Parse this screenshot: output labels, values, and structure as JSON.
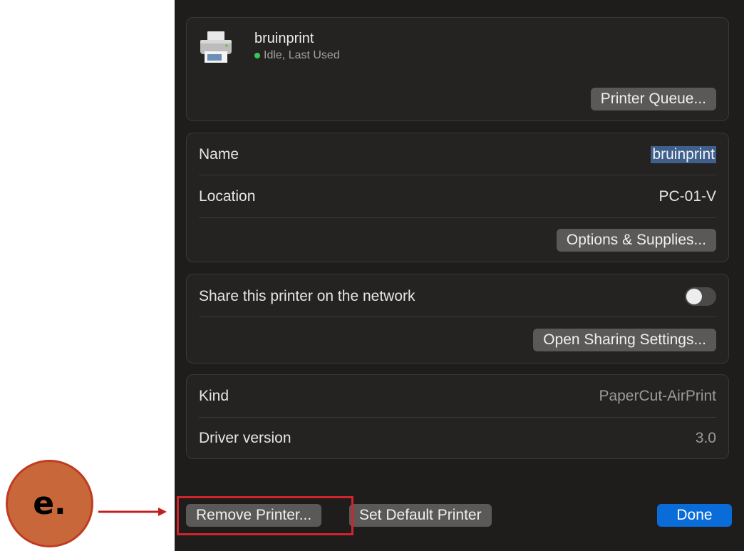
{
  "printer": {
    "name": "bruinprint",
    "status": "Idle, Last Used",
    "status_color": "#34c759",
    "queue_button": "Printer Queue..."
  },
  "details": {
    "name_label": "Name",
    "name_value": "bruinprint",
    "location_label": "Location",
    "location_value": "PC-01-V",
    "options_button": "Options & Supplies..."
  },
  "sharing": {
    "label": "Share this printer on the network",
    "toggle_on": false,
    "settings_button": "Open Sharing Settings..."
  },
  "info": {
    "kind_label": "Kind",
    "kind_value": "PaperCut-AirPrint",
    "driver_label": "Driver version",
    "driver_value": "3.0"
  },
  "footer": {
    "remove_button": "Remove Printer...",
    "default_button": "Set Default Printer",
    "done_button": "Done"
  },
  "annotation": {
    "marker_label": "e.",
    "marker_color": "#c8683a",
    "highlight_color": "#d0242b"
  }
}
